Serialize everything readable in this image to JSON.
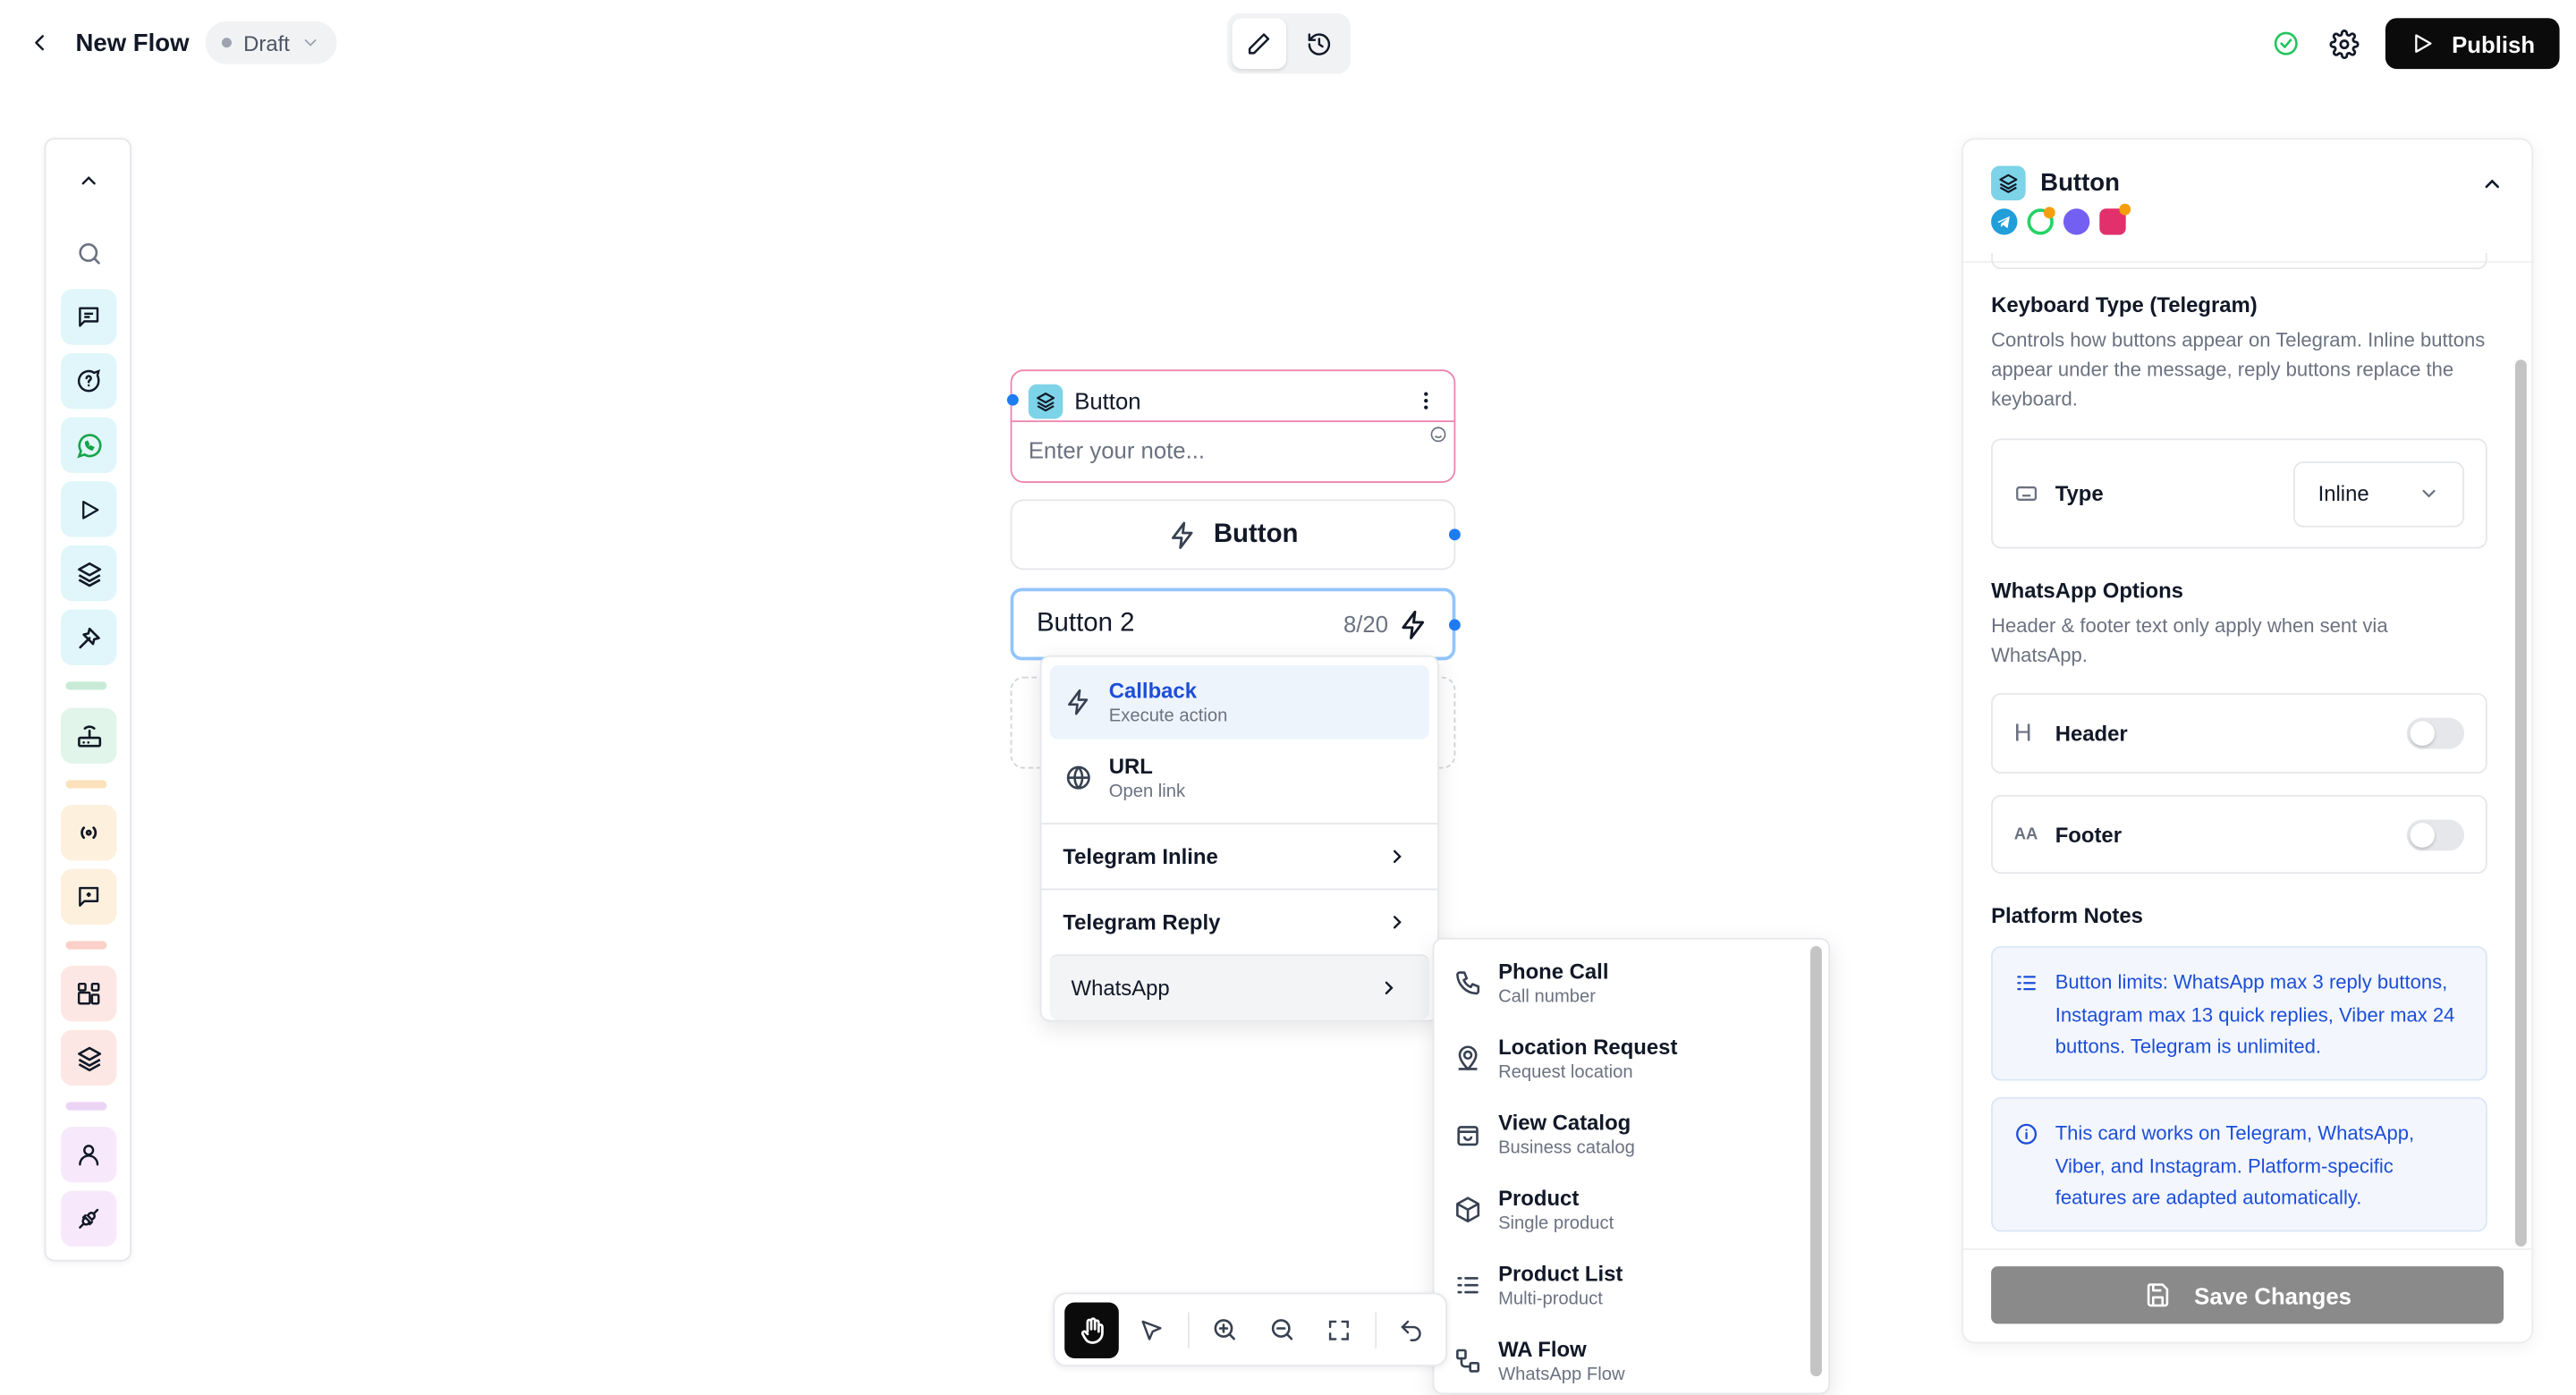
{
  "topbar": {
    "title": "New Flow",
    "status": "Draft",
    "publish_label": "Publish"
  },
  "canvas": {
    "node": {
      "title": "Button",
      "note_placeholder": "Enter your note...",
      "button1_label": "Button",
      "button2_label": "Button 2",
      "button2_count": "8/20"
    },
    "menu": {
      "items": [
        {
          "label": "Callback",
          "sub": "Execute action"
        },
        {
          "label": "URL",
          "sub": "Open link"
        }
      ],
      "groups": [
        "Telegram Inline",
        "Telegram Reply",
        "WhatsApp"
      ]
    },
    "submenu": {
      "items": [
        {
          "label": "Phone Call",
          "sub": "Call number",
          "icon": "phone-icon"
        },
        {
          "label": "Location Request",
          "sub": "Request location",
          "icon": "location-icon"
        },
        {
          "label": "View Catalog",
          "sub": "Business catalog",
          "icon": "shopping-bag-icon"
        },
        {
          "label": "Product",
          "sub": "Single product",
          "icon": "package-icon"
        },
        {
          "label": "Product List",
          "sub": "Multi-product",
          "icon": "list-icon"
        },
        {
          "label": "WA Flow",
          "sub": "WhatsApp Flow",
          "icon": "flow-icon"
        }
      ]
    }
  },
  "panel": {
    "title": "Button",
    "keyboard": {
      "title": "Keyboard Type (Telegram)",
      "desc": "Controls how buttons appear on Telegram. Inline buttons appear under the message, reply buttons replace the keyboard.",
      "type_label": "Type",
      "type_value": "Inline"
    },
    "whatsapp": {
      "title": "WhatsApp Options",
      "desc": "Header & footer text only apply when sent via WhatsApp.",
      "header_label": "Header",
      "footer_label": "Footer"
    },
    "notes": {
      "title": "Platform Notes",
      "limits": "Button limits: WhatsApp max 3 reply buttons, Instagram max 13 quick replies, Viber max 24 buttons. Telegram is unlimited.",
      "info": "This card works on Telegram, WhatsApp, Viber, and Instagram. Platform-specific features are adapted automatically."
    },
    "save_label": "Save Changes"
  },
  "colors": {
    "accent": "#1e7bf2",
    "node_border": "#ec86b0",
    "note_text": "#1d4ed8",
    "status_ok": "#22c55e",
    "publish_bg": "#0b0b0c"
  }
}
